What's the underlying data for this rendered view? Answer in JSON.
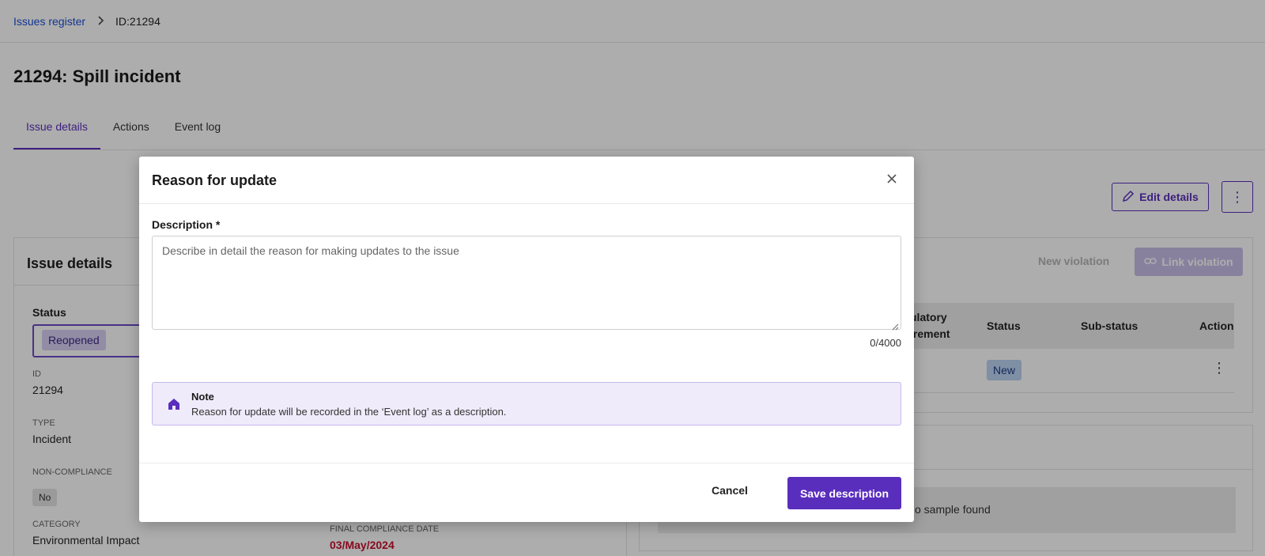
{
  "breadcrumb": {
    "link": "Issues register",
    "current": "ID:21294"
  },
  "page": {
    "title": "21294: Spill incident"
  },
  "tabs": [
    {
      "label": "Issue details"
    },
    {
      "label": "Actions"
    },
    {
      "label": "Event log"
    }
  ],
  "toolbar": {
    "edit_label": "Edit details",
    "more_icon": "kebab-vertical-icon"
  },
  "issue_details": {
    "heading": "Issue details",
    "status_label": "Status",
    "status_value": "Reopened",
    "id_label": "ID",
    "id_value": "21294",
    "type_label": "TYPE",
    "type_value": "Incident",
    "noncompliance_label": "NON-COMPLIANCE",
    "noncompliance_value": "No",
    "category_label": "CATEGORY",
    "category_value": "Environmental Impact",
    "final_date_label": "FINAL COMPLIANCE DATE",
    "final_date_value": "03/May/2024"
  },
  "violations": {
    "new_label": "New violation",
    "link_label": "Link violation",
    "columns": {
      "requirement_line1": "ulatory",
      "requirement_line2": "irement",
      "status": "Status",
      "substatus": "Sub-status",
      "action": "Action"
    },
    "rows": [
      {
        "status": "New"
      }
    ]
  },
  "samples": {
    "empty_text": "o sample found"
  },
  "modal": {
    "title": "Reason for update",
    "description_label": "Description *",
    "description_placeholder": "Describe in detail the reason for making updates to the issue",
    "counter": "0/4000",
    "note_title": "Note",
    "note_text": "Reason for update will be recorded in the ‘Event log’ as a description.",
    "cancel_label": "Cancel",
    "save_label": "Save description"
  },
  "colors": {
    "accent": "#5a2ebd",
    "link": "#1c4fd6",
    "danger": "#c8102e"
  }
}
